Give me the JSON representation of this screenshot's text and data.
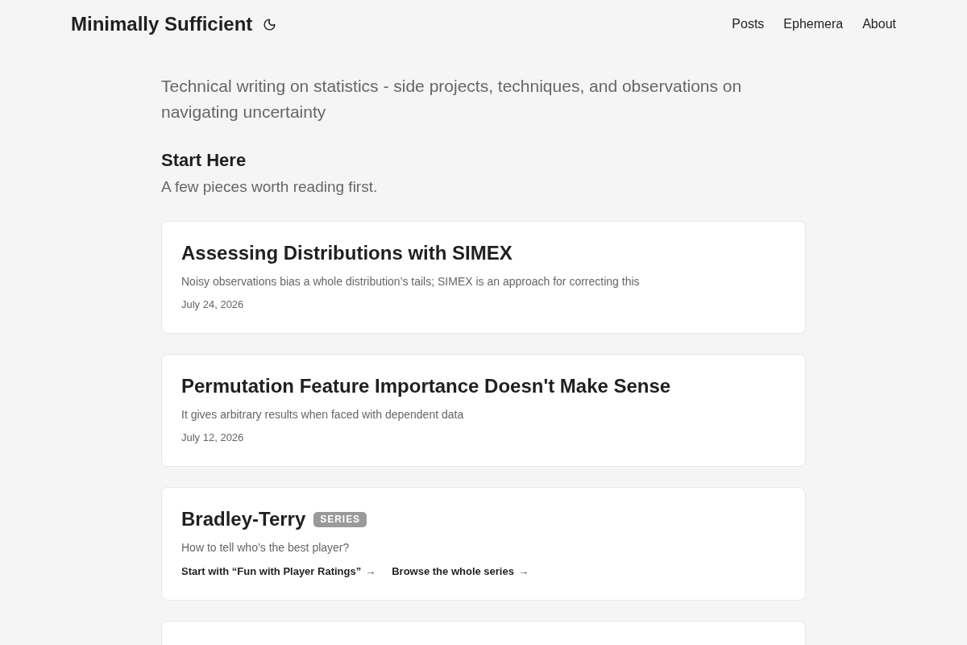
{
  "site": {
    "title": "Minimally Sufficient",
    "nav": [
      "Posts",
      "Ephemera",
      "About"
    ]
  },
  "intro": {
    "tagline": "Technical writing on statistics - side projects, techniques, and observations on navigating uncertainty",
    "section_title": "Start Here",
    "section_subtitle": "A few pieces worth reading first."
  },
  "posts": [
    {
      "kind": "article",
      "title": "Assessing Distributions with SIMEX",
      "summary": "Noisy observations bias a whole distribution’s tails; SIMEX is an approach for correcting this",
      "date": "July 24, 2026"
    },
    {
      "kind": "article",
      "title": "Permutation Feature Importance Doesn't Make Sense",
      "summary": "It gives arbitrary results when faced with dependent data",
      "date": "July 12, 2026"
    },
    {
      "kind": "series",
      "title": "Bradley-Terry",
      "badge": "SERIES",
      "summary": "How to tell who’s the best player?",
      "links": [
        {
          "label": "Start with “Fun with Player Ratings”",
          "arrow": "→"
        },
        {
          "label": "Browse the whole series",
          "arrow": "→"
        }
      ]
    }
  ]
}
